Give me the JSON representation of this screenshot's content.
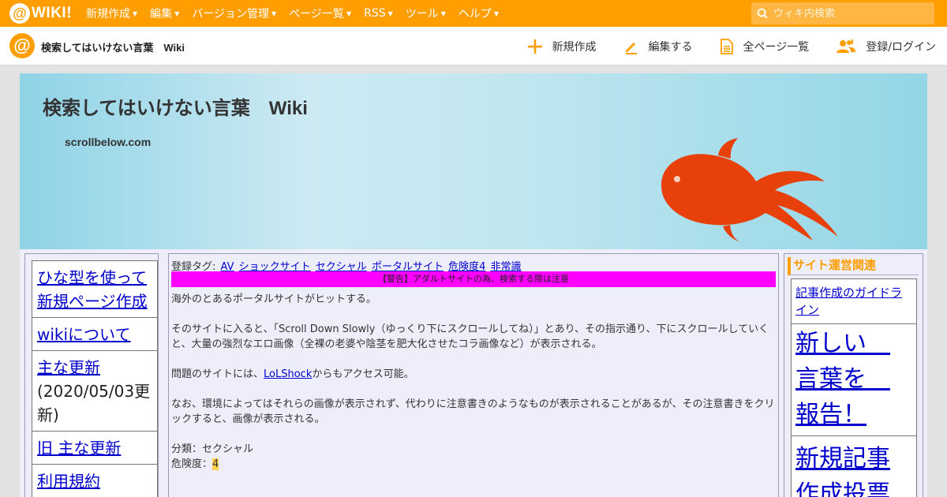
{
  "topbar": {
    "logo_text": "WIKI!",
    "menu": [
      {
        "label": "新規作成"
      },
      {
        "label": "編集"
      },
      {
        "label": "バージョン管理"
      },
      {
        "label": "ページ一覧"
      },
      {
        "label": "RSS"
      },
      {
        "label": "ツール"
      },
      {
        "label": "ヘルプ"
      }
    ],
    "search_placeholder": "ウィキ内検索"
  },
  "subbar": {
    "site_title": "検索してはいけない言葉　Wiki",
    "actions": [
      {
        "label": "新規作成",
        "icon": "plus-icon"
      },
      {
        "label": "編集する",
        "icon": "pencil-icon"
      },
      {
        "label": "全ページ一覧",
        "icon": "document-icon"
      },
      {
        "label": "登録/ログイン",
        "icon": "users-icon"
      }
    ]
  },
  "banner": {
    "title": "検索してはいけない言葉　Wiki",
    "subtitle": "scrollbelow.com"
  },
  "left_nav": {
    "items": [
      {
        "label": "ひな型を使って新規ページ作成",
        "note": ""
      },
      {
        "label": "wikiについて",
        "note": ""
      },
      {
        "label": "主な更新",
        "note": "(2020/05/03更新)"
      },
      {
        "label": "旧 主な更新",
        "note": ""
      },
      {
        "label": "利用規約",
        "note": ""
      }
    ]
  },
  "main": {
    "tags_label": "登録タグ:",
    "tags": [
      "AV",
      "ショックサイト",
      "セクシャル",
      "ポータルサイト",
      "危険度4",
      "非常識"
    ],
    "warning": "【警告】アダルトサイトの為、検索する際は注意",
    "para1": "海外のとあるポータルサイトがヒットする。",
    "para2": "そのサイトに入ると、「Scroll Down Slowly（ゆっくり下にスクロールしてね）」とあり、その指示通り、下にスクロールしていくと、大量の強烈なエロ画像（全裸の老婆や陰茎を肥大化させたコラ画像など）が表示される。",
    "para3_before": "問題のサイトには、",
    "para3_link": "LoLShock",
    "para3_after": "からもアクセス可能。",
    "para4": "なお、環境によってはそれらの画像が表示されず、代わりに注意書きのようなものが表示されることがあるが、その注意書きをクリックすると、画像が表示される。",
    "category_label": "分類：",
    "category_value": "セクシャル",
    "danger_label": "危険度：",
    "danger_value": "4"
  },
  "right_nav": {
    "heading": "サイト運営関連",
    "items": [
      {
        "label": "記事作成のガイドライン"
      },
      {
        "label": "新しい　言葉を　報告！"
      },
      {
        "label": "新規記事作成投票"
      }
    ]
  },
  "colors": {
    "brand_orange": "#ff9e00",
    "warning_magenta": "#ff00ff",
    "link_blue": "#0000cc",
    "fish_red": "#e8400a"
  }
}
